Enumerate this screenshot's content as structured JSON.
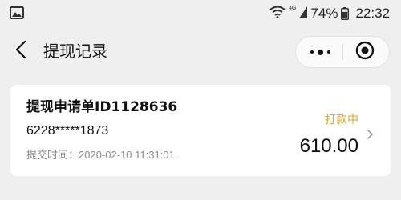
{
  "status_bar": {
    "left_icon": "image-icon",
    "wifi_icon": "wifi-icon",
    "network_label": "4G",
    "signal_icon": "signal-icon",
    "battery_percent": "74%",
    "battery_icon": "battery-icon",
    "battery_level": 0.74,
    "time": "22:32"
  },
  "nav": {
    "back_icon": "chevron-left-icon",
    "title": "提现记录",
    "more_icon": "more-dots-icon",
    "close_icon": "target-circle-icon"
  },
  "record": {
    "title": "提现申请单ID1128636",
    "account": "6228*****1873",
    "time_label": "提交时间：",
    "time_value": "2020-02-10 11:31:01",
    "status": "打款中",
    "status_color": "#e3a51c",
    "amount": "610.00",
    "chevron_icon": "chevron-right-icon"
  }
}
